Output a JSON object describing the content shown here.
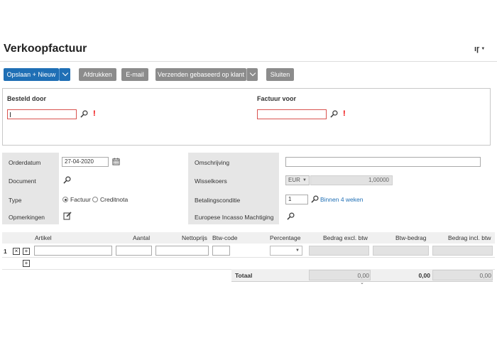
{
  "header": {
    "title": "Verkoopfactuur",
    "settings_label": "ıɼ"
  },
  "toolbar": {
    "save_new": "Opslaan + Nieuw",
    "print": "Afdrukken",
    "email": "E-mail",
    "send_based_on_customer": "Verzenden gebaseerd op klant",
    "close": "Sluiten"
  },
  "parties": {
    "ordered_by_label": "Besteld door",
    "ordered_by_value": "",
    "invoice_to_label": "Factuur voor",
    "invoice_to_value": ""
  },
  "details": {
    "order_date_label": "Orderdatum",
    "order_date_value": "27-04-2020",
    "document_label": "Document",
    "type_label": "Type",
    "type_options": [
      "Factuur",
      "Creditnota"
    ],
    "type_selected": "Factuur",
    "remarks_label": "Opmerkingen",
    "description_label": "Omschrijving",
    "description_value": "",
    "exchange_rate_label": "Wisselkoers",
    "currency_value": "EUR",
    "exchange_rate_value": "1,00000",
    "payment_condition_label": "Betalingsconditie",
    "payment_condition_value": "1",
    "payment_condition_text": "Binnen 4 weken",
    "sepa_mandate_label": "Europese Incasso Machtiging"
  },
  "lines": {
    "columns": [
      "Artikel",
      "Aantal",
      "Nettoprijs",
      "Btw-code",
      "Percentage",
      "Bedrag excl. btw",
      "Btw-bedrag",
      "Bedrag incl. btw"
    ],
    "rows": [
      {
        "number": "1"
      }
    ],
    "total_label": "Totaal",
    "total_excl": "0,00",
    "total_vat": "0,00",
    "total_incl": "0,00"
  },
  "colors": {
    "primary": "#1f6fb5",
    "secondary_button": "#8c8c8c",
    "required": "#e00000",
    "link": "#1f6fb5"
  },
  "icons": [
    "search-icon",
    "calendar-icon",
    "edit-icon",
    "required-icon",
    "add-icon",
    "delete-icon",
    "chevron-down-icon"
  ]
}
